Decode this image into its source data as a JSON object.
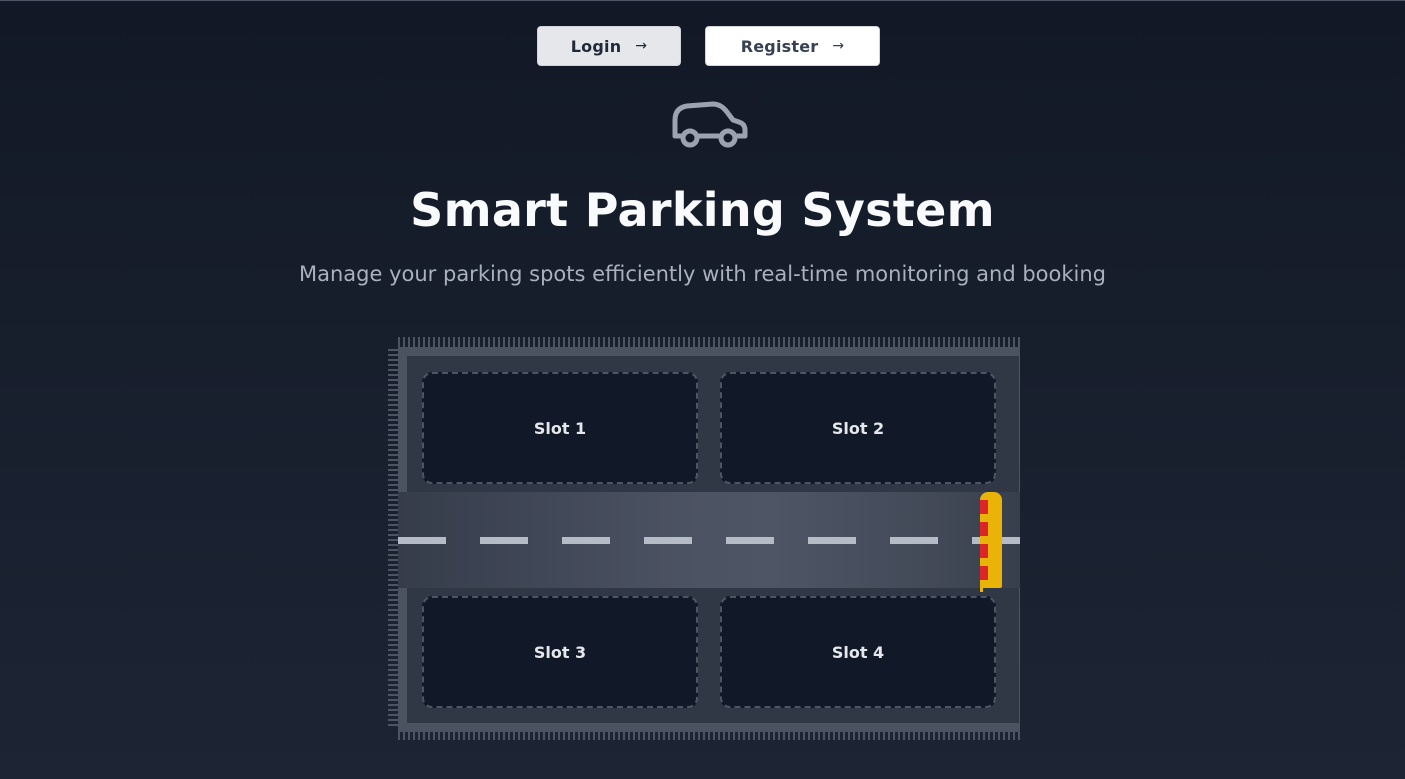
{
  "auth": {
    "login_label": "Login",
    "register_label": "Register",
    "arrow": "→"
  },
  "hero": {
    "icon": "car-icon",
    "title": "Smart Parking System",
    "subtitle": "Manage your parking spots efficiently with real-time monitoring and booking"
  },
  "parking_lot": {
    "slots": [
      {
        "label": "Slot 1"
      },
      {
        "label": "Slot 2"
      },
      {
        "label": "Slot 3"
      },
      {
        "label": "Slot 4"
      }
    ],
    "gate_icon": "barrier-gate-icon"
  },
  "colors": {
    "background": "#121826",
    "slot_fill": "#111827",
    "road": "#4b5262",
    "gate": "#eab308",
    "gate_stripe": "#dc2626"
  }
}
